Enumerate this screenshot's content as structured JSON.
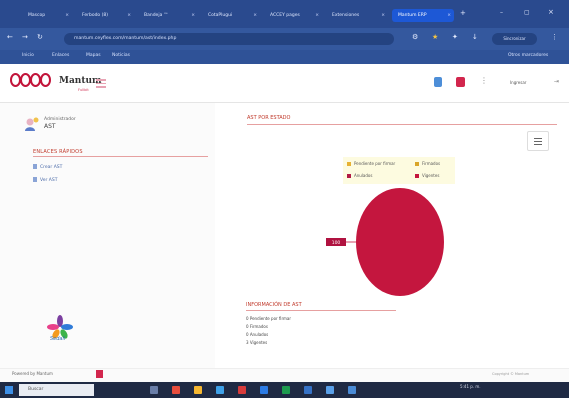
{
  "browser": {
    "tabs": [
      {
        "label": "Mascop"
      },
      {
        "label": "Ferbodo (8)"
      },
      {
        "label": "Bandeja ™"
      },
      {
        "label": "CotaPlugui"
      },
      {
        "label": "ACCEY pages"
      },
      {
        "label": "Extensiones"
      },
      {
        "label": "Mantum ERP"
      }
    ],
    "url": "mantum.ceyflex.com/mantum/ast/index.php",
    "profile_label": "Sincronizar",
    "bookmarks": [
      "Inicio",
      "Enlaces",
      "Mapas",
      "Noticias"
    ],
    "bookmarks_right": "Otros marcadores"
  },
  "app": {
    "brand": "Mantum",
    "brand_sub": "Fullbit",
    "header_user": "Ingresar"
  },
  "sidebar": {
    "user_name": "Administrador",
    "user_role": "AST",
    "links_title": "ENLACES RÁPIDOS",
    "links": [
      "Crear AST",
      "Ver AST"
    ],
    "logo_text": "Sedali"
  },
  "main": {
    "chart_title": "AST POR ESTADO",
    "info_title": "INFORMACIÓN DE AST",
    "info_items": [
      "0 Pendiente por firmar",
      "0 Firmados",
      "0 Anulados",
      "3 Vigentes"
    ]
  },
  "chart_data": {
    "type": "pie",
    "legend": [
      "Pendiente por firmar",
      "Firmados",
      "Anulados",
      "Vigentes"
    ],
    "values": [
      0,
      0,
      0,
      3
    ],
    "colors": [
      "#e7b233",
      "#d9a52a",
      "#b21a45",
      "#c4163e"
    ],
    "data_label": "100",
    "legend_position": "top"
  },
  "footer": {
    "left": "Powered by Mantum",
    "right": "Copyright © Mantum"
  },
  "taskbar": {
    "search_placeholder": "Buscar",
    "clock": "5:41 p. m."
  }
}
